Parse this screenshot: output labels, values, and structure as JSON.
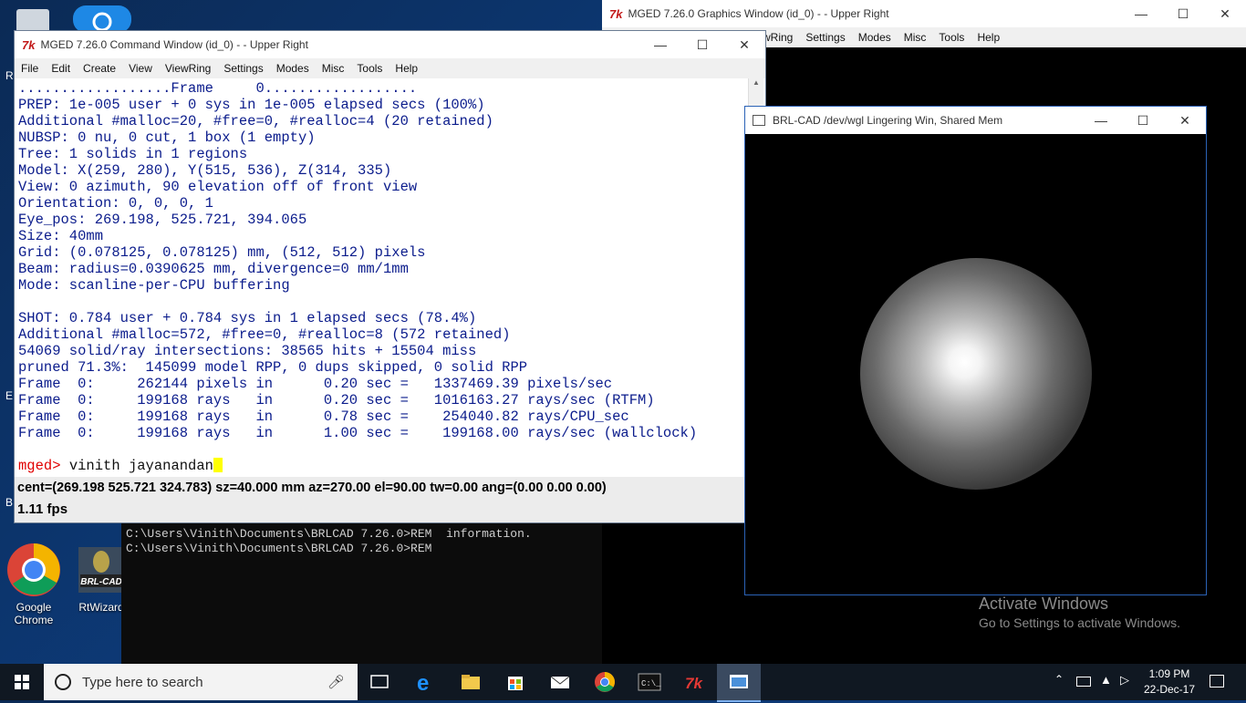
{
  "desktop": {
    "icons": [
      {
        "label": "Google Chrome"
      },
      {
        "label": "RtWizard"
      }
    ],
    "partial_left_labels": [
      "R",
      "E",
      "B"
    ],
    "watermark": {
      "line1": "Activate Windows",
      "line2": "Go to Settings to activate Windows."
    }
  },
  "graphics_window": {
    "title": "MGED 7.26.0 Graphics Window (id_0) -  - Upper Right",
    "menu": [
      "wRing",
      "Settings",
      "Modes",
      "Misc",
      "Tools",
      "Help"
    ]
  },
  "command_window": {
    "title": "MGED 7.26.0 Command Window (id_0) -  - Upper Right",
    "menu": [
      "File",
      "Edit",
      "Create",
      "View",
      "ViewRing",
      "Settings",
      "Modes",
      "Misc",
      "Tools",
      "Help"
    ],
    "lines": [
      "..................Frame     0..................",
      "PREP: 1e-005 user + 0 sys in 1e-005 elapsed secs (100%)",
      "Additional #malloc=20, #free=0, #realloc=4 (20 retained)",
      "NUBSP: 0 nu, 0 cut, 1 box (1 empty)",
      "Tree: 1 solids in 1 regions",
      "Model: X(259, 280), Y(515, 536), Z(314, 335)",
      "View: 0 azimuth, 90 elevation off of front view",
      "Orientation: 0, 0, 0, 1",
      "Eye_pos: 269.198, 525.721, 394.065",
      "Size: 40mm",
      "Grid: (0.078125, 0.078125) mm, (512, 512) pixels",
      "Beam: radius=0.0390625 mm, divergence=0 mm/1mm",
      "Mode: scanline-per-CPU buffering",
      "",
      "SHOT: 0.784 user + 0.784 sys in 1 elapsed secs (78.4%)",
      "Additional #malloc=572, #free=0, #realloc=8 (572 retained)",
      "54069 solid/ray intersections: 38565 hits + 15504 miss",
      "pruned 71.3%:  145099 model RPP, 0 dups skipped, 0 solid RPP",
      "Frame  0:     262144 pixels in      0.20 sec =   1337469.39 pixels/sec",
      "Frame  0:     199168 rays   in      0.20 sec =   1016163.27 rays/sec (RTFM)",
      "Frame  0:     199168 rays   in      0.78 sec =    254040.82 rays/CPU_sec",
      "Frame  0:     199168 rays   in      1.00 sec =    199168.00 rays/sec (wallclock)",
      ""
    ],
    "prompt": "mged>",
    "input": "vinith jayanandan",
    "status_line": "cent=(269.198 525.721 324.783) sz=40.000  mm  az=270.00  el=90.00  tw=0.00  ang=(0.00 0.00 0.00)",
    "fps": "1.11 fps"
  },
  "framebuffer_window": {
    "title": "BRL-CAD /dev/wgl Lingering Win, Shared Mem"
  },
  "dos_window": {
    "lines": [
      "C:\\Users\\Vinith\\Documents\\BRLCAD 7.26.0>REM  information.",
      "",
      "C:\\Users\\Vinith\\Documents\\BRLCAD 7.26.0>REM"
    ]
  },
  "taskbar": {
    "search_placeholder": "Type here to search",
    "time": "1:09 PM",
    "date": "22-Dec-17"
  },
  "colors": {
    "prompt": "#e00000",
    "cursor": "#ffff00",
    "text": "#0b1c8c"
  }
}
